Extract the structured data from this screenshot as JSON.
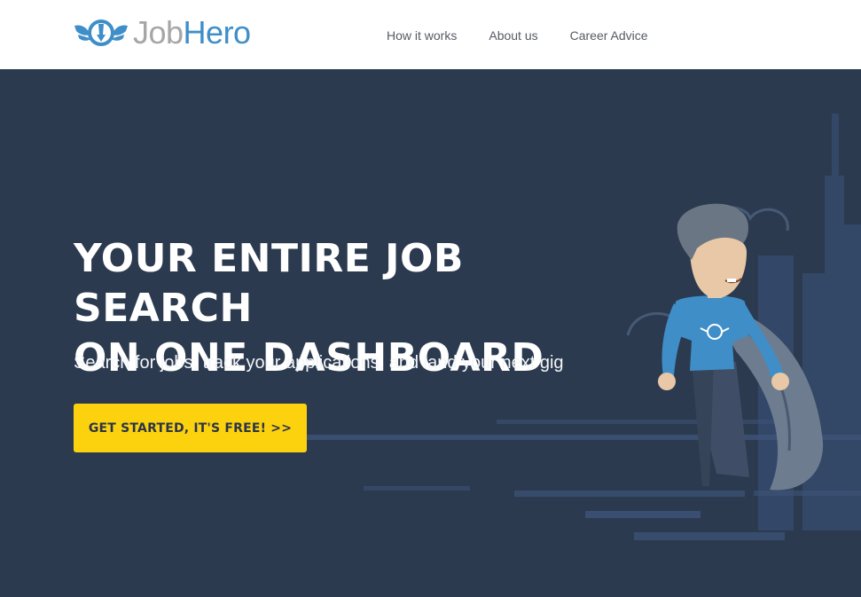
{
  "brand": {
    "name_part1": "Job",
    "name_part2": "Hero"
  },
  "nav": {
    "items": [
      {
        "label": "How it works"
      },
      {
        "label": "About us"
      },
      {
        "label": "Career Advice"
      }
    ]
  },
  "hero": {
    "title_line1": "YOUR ENTIRE JOB SEARCH",
    "title_line2": "ON ONE DASHBOARD",
    "subtitle": "Search for jobs, track your applications, and land your next gig",
    "cta_label": "GET STARTED, IT'S FREE! >>"
  },
  "colors": {
    "header_bg": "#ffffff",
    "hero_bg": "#2b3a4f",
    "brand_blue": "#3f8ec8",
    "cta_yellow": "#fcd20f",
    "nav_text": "#555b63"
  },
  "illustration": {
    "subject": "superhero-with-cape-illustration"
  }
}
